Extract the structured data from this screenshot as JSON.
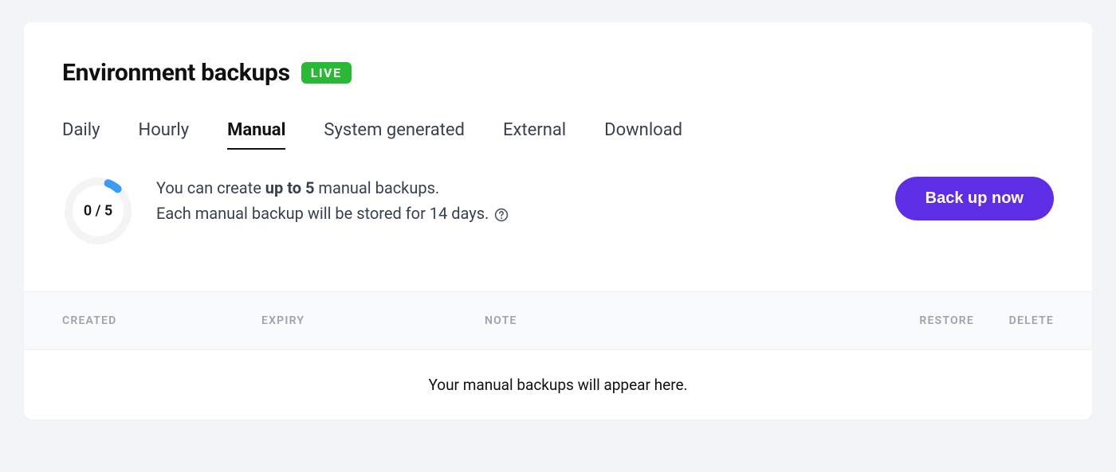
{
  "header": {
    "title": "Environment backups",
    "badge": "LIVE"
  },
  "tabs": [
    {
      "label": "Daily",
      "active": false
    },
    {
      "label": "Hourly",
      "active": false
    },
    {
      "label": "Manual",
      "active": true
    },
    {
      "label": "System generated",
      "active": false
    },
    {
      "label": "External",
      "active": false
    },
    {
      "label": "Download",
      "active": false
    }
  ],
  "progress": {
    "label": "0 / 5"
  },
  "info": {
    "line1_prefix": "You can create ",
    "line1_bold": "up to 5",
    "line1_suffix": " manual backups.",
    "line2": "Each manual backup will be stored for 14 days."
  },
  "actions": {
    "backup_now": "Back up now"
  },
  "columns": {
    "created": "CREATED",
    "expiry": "EXPIRY",
    "note": "NOTE",
    "restore": "RESTORE",
    "delete": "DELETE"
  },
  "empty_message": "Your manual backups will appear here."
}
